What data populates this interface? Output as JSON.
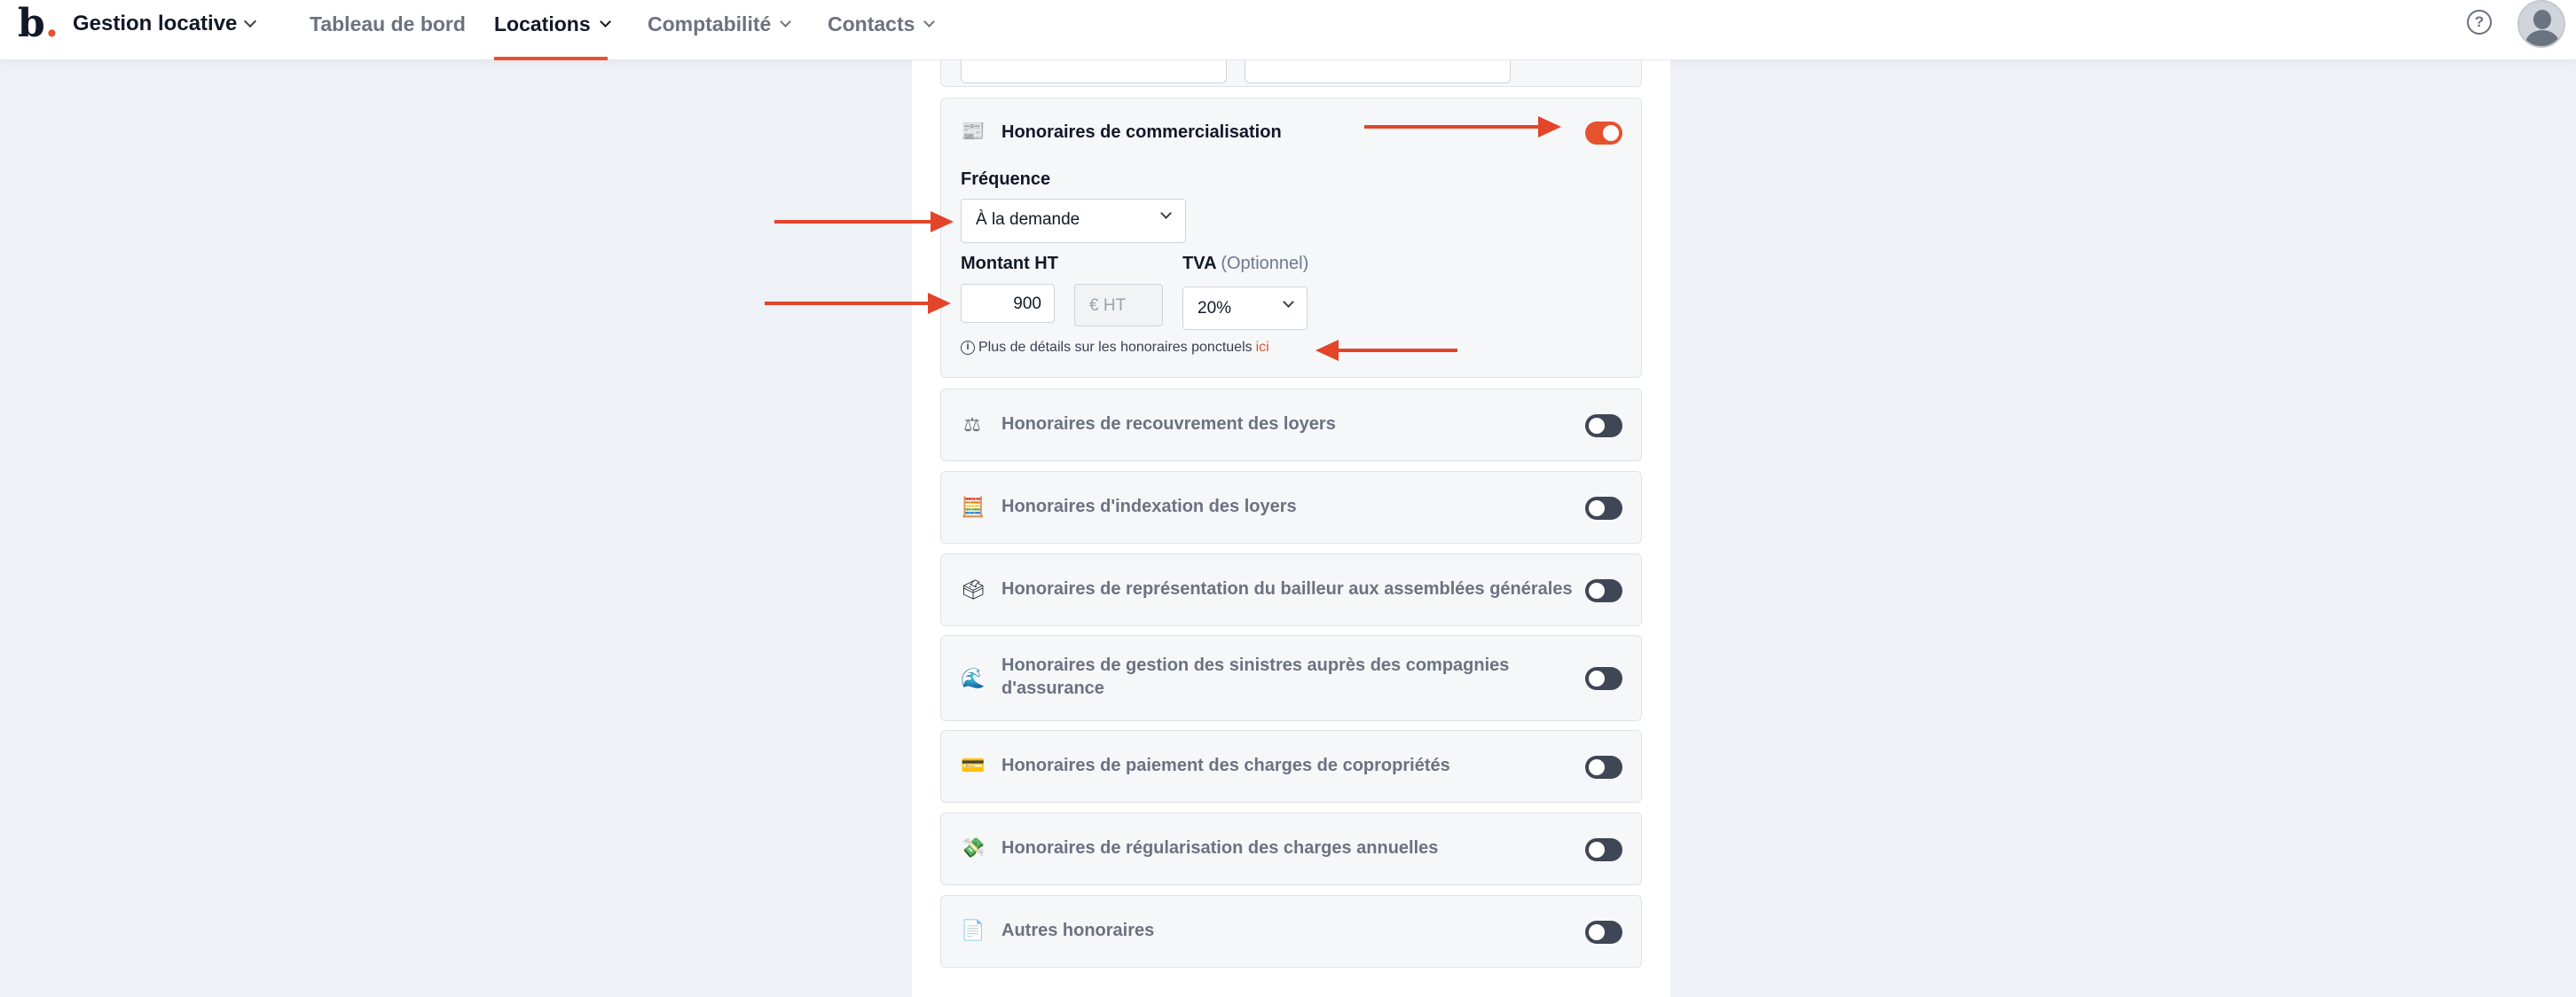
{
  "topbar": {
    "logo_letter": "b",
    "logo_dot": ".",
    "brand": "Gestion locative",
    "nav": [
      {
        "label": "Tableau de bord"
      },
      {
        "label": "Locations"
      },
      {
        "label": "Comptabilité"
      },
      {
        "label": "Contacts"
      }
    ],
    "active_nav": "Locations",
    "help_icon": "?"
  },
  "commercialisation": {
    "icon": "newspaper-icon",
    "title": "Honoraires de commercialisation",
    "enabled": true,
    "frequence_label": "Fréquence",
    "frequence_value": "À la demande",
    "montant_label": "Montant HT",
    "montant_value": "900",
    "unit_placeholder": "€ HT",
    "tva_label": "TVA",
    "tva_optional": "(Optionnel)",
    "tva_value": "20%",
    "info_text": "Plus de détails sur les honoraires ponctuels",
    "info_link": "ici"
  },
  "fees": [
    {
      "icon": "balance-icon",
      "glyph": "⚖",
      "title": "Honoraires de recouvrement des loyers",
      "enabled": false
    },
    {
      "icon": "abacus-icon",
      "glyph": "🧮",
      "title": "Honoraires d'indexation des loyers",
      "enabled": false
    },
    {
      "icon": "ballot-box-icon",
      "glyph": "🗳",
      "title": "Honoraires de représentation du bailleur aux assemblées générales",
      "enabled": false
    },
    {
      "icon": "flood-icon",
      "glyph": "🌊",
      "title_line1": "Honoraires de gestion des sinistres auprès des compagnies",
      "title_line2": "d'assurance",
      "enabled": false
    },
    {
      "icon": "credit-card-icon",
      "glyph": "💳",
      "title": "Honoraires de paiement des charges de copropriétés",
      "enabled": false
    },
    {
      "icon": "money-wings-icon",
      "glyph": "💸",
      "title": "Honoraires de régularisation des charges annuelles",
      "enabled": false
    },
    {
      "icon": "document-icon",
      "glyph": "📄",
      "title": "Autres honoraires",
      "enabled": false
    }
  ],
  "colors": {
    "accent": "#e5522d",
    "toggle_off": "#3f4655",
    "background": "#eef1f6"
  }
}
